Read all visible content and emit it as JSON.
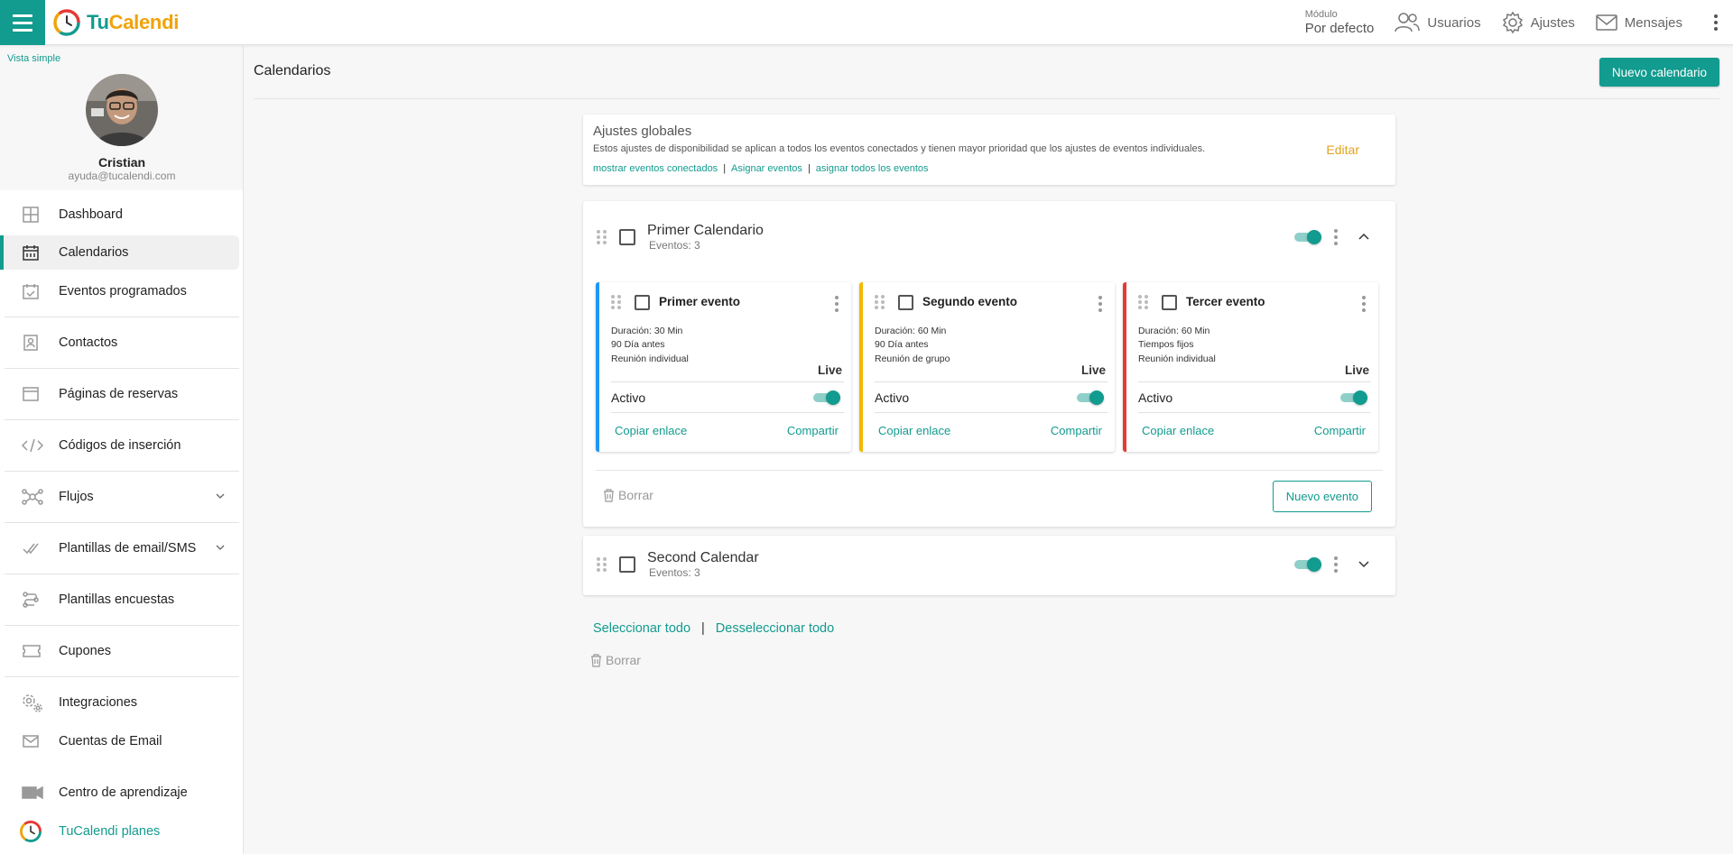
{
  "app": {
    "logo_tu": "Tu",
    "logo_cal": "Calendi"
  },
  "topbar": {
    "module_label": "Módulo",
    "module_value": "Por defecto",
    "users": "Usuarios",
    "settings": "Ajustes",
    "messages": "Mensajes"
  },
  "sidebar": {
    "simple_view": "Vista simple",
    "profile_name": "Cristian",
    "profile_email": "ayuda@tucalendi.com",
    "items": [
      {
        "label": "Dashboard"
      },
      {
        "label": "Calendarios"
      },
      {
        "label": "Eventos programados"
      },
      {
        "label": "Contactos"
      },
      {
        "label": "Páginas de reservas"
      },
      {
        "label": "Códigos de inserción"
      },
      {
        "label": "Flujos"
      },
      {
        "label": "Plantillas de email/SMS"
      },
      {
        "label": "Plantillas encuestas"
      },
      {
        "label": "Cupones"
      },
      {
        "label": "Integraciones"
      },
      {
        "label": "Cuentas de Email"
      },
      {
        "label": "Centro de aprendizaje"
      },
      {
        "label": "TuCalendi planes"
      }
    ]
  },
  "main": {
    "title": "Calendarios",
    "new_calendar": "Nuevo calendario",
    "global": {
      "title": "Ajustes globales",
      "desc": "Estos ajustes de disponibilidad se aplican a todos los eventos conectados y tienen mayor prioridad que los ajustes de eventos individuales.",
      "link1": "mostrar eventos conectados",
      "link2": "Asignar eventos",
      "link3": "asignar todos los eventos",
      "sep": "|",
      "edit": "Editar"
    },
    "calendars": [
      {
        "name": "Primer Calendario",
        "count": "Eventos: 3",
        "events": [
          {
            "title": "Primer evento",
            "duration": "Duración: 30 Min",
            "window": "90 Día antes",
            "type": "Reunión individual",
            "live": "Live",
            "active": "Activo",
            "copy": "Copiar enlace",
            "share": "Compartir",
            "color": "#2196f3"
          },
          {
            "title": "Segundo evento",
            "duration": "Duración: 60 Min",
            "window": "90 Día antes",
            "type": "Reunión de grupo",
            "live": "Live",
            "active": "Activo",
            "copy": "Copiar enlace",
            "share": "Compartir",
            "color": "#f5b800"
          },
          {
            "title": "Tercer evento",
            "duration": "Duración: 60 Min",
            "window": "Tiempos fijos",
            "type": "Reunión individual",
            "live": "Live",
            "active": "Activo",
            "copy": "Copiar enlace",
            "share": "Compartir",
            "color": "#e53935"
          }
        ],
        "delete": "Borrar",
        "new_event": "Nuevo evento"
      },
      {
        "name": "Second Calendar",
        "count": "Eventos: 3"
      }
    ],
    "select_all": "Seleccionar todo",
    "deselect_all": "Desseleccionar todo",
    "sep": "|",
    "delete": "Borrar"
  }
}
